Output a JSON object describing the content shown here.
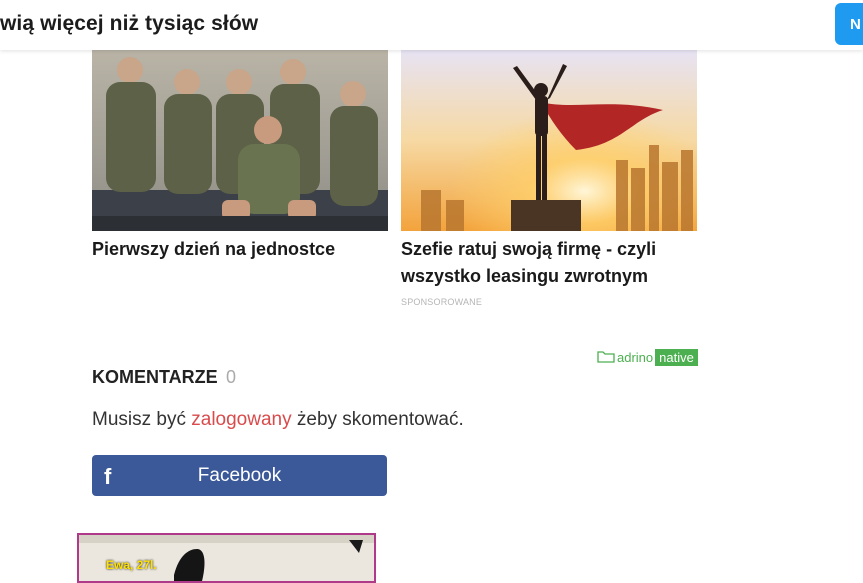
{
  "header": {
    "title": "wią więcej niż tysiąc słów",
    "button_label": "N"
  },
  "cards": [
    {
      "headline": "Pierwszy dzień na jednostce",
      "image": "soldiers-photo"
    },
    {
      "headline": "Szefie ratuj swoją firmę - czyli wszystko leasingu zwrotnym",
      "image": "superhero-cityscape-photo",
      "sponsored": "SPONSOROWANE"
    }
  ],
  "adrino": {
    "word": "adrino",
    "native": "native"
  },
  "comments": {
    "heading": "KOMENTARZE",
    "count": "0",
    "login_prefix": "Musisz być",
    "login_link": "zalogowany",
    "login_suffix": "żeby skomentować."
  },
  "facebook": {
    "label": "Facebook"
  },
  "bottom_ad": {
    "caption": "Ewa, 27l."
  },
  "colors": {
    "accent_blue": "#1e9bf0",
    "facebook_blue": "#3b5998",
    "link_red": "#d94b4b",
    "adrino_green": "#4caf50",
    "ad_border": "#b03a8a"
  }
}
